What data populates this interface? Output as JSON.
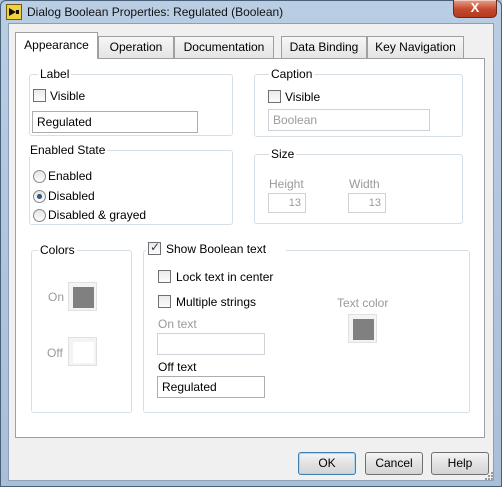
{
  "window": {
    "title": "Dialog Boolean Properties: Regulated (Boolean)",
    "close_glyph": "X"
  },
  "tabs": [
    {
      "label": "Appearance",
      "active": true
    },
    {
      "label": "Operation",
      "active": false
    },
    {
      "label": "Documentation",
      "active": false
    },
    {
      "label": "Data Binding",
      "active": false
    },
    {
      "label": "Key Navigation",
      "active": false
    }
  ],
  "label_group": {
    "title": "Label",
    "visible_label": "Visible",
    "visible_checked": false,
    "value": "Regulated"
  },
  "caption_group": {
    "title": "Caption",
    "visible_label": "Visible",
    "visible_checked": false,
    "placeholder": "Boolean"
  },
  "enabled_state": {
    "title": "Enabled State",
    "options": [
      "Enabled",
      "Disabled",
      "Disabled & grayed"
    ],
    "selected": "Disabled"
  },
  "size_group": {
    "title": "Size",
    "height_label": "Height",
    "height_value": "13",
    "width_label": "Width",
    "width_value": "13"
  },
  "colors_group": {
    "title": "Colors",
    "on_label": "On",
    "on_color": "#808080",
    "off_label": "Off",
    "off_color": "#ffffff"
  },
  "boolean_text": {
    "show_label": "Show Boolean text",
    "show_checked": true,
    "lock_label": "Lock text in center",
    "lock_checked": false,
    "multiple_label": "Multiple strings",
    "multiple_checked": false,
    "on_text_label": "On text",
    "on_text_value": "",
    "off_text_label": "Off text",
    "off_text_value": "Regulated",
    "text_color_label": "Text color",
    "text_color": "#808080"
  },
  "buttons": {
    "ok": "OK",
    "cancel": "Cancel",
    "help": "Help"
  },
  "icons": {
    "app": "labview-boolean-icon",
    "close": "close-icon",
    "grip": "resize-grip-icon"
  }
}
